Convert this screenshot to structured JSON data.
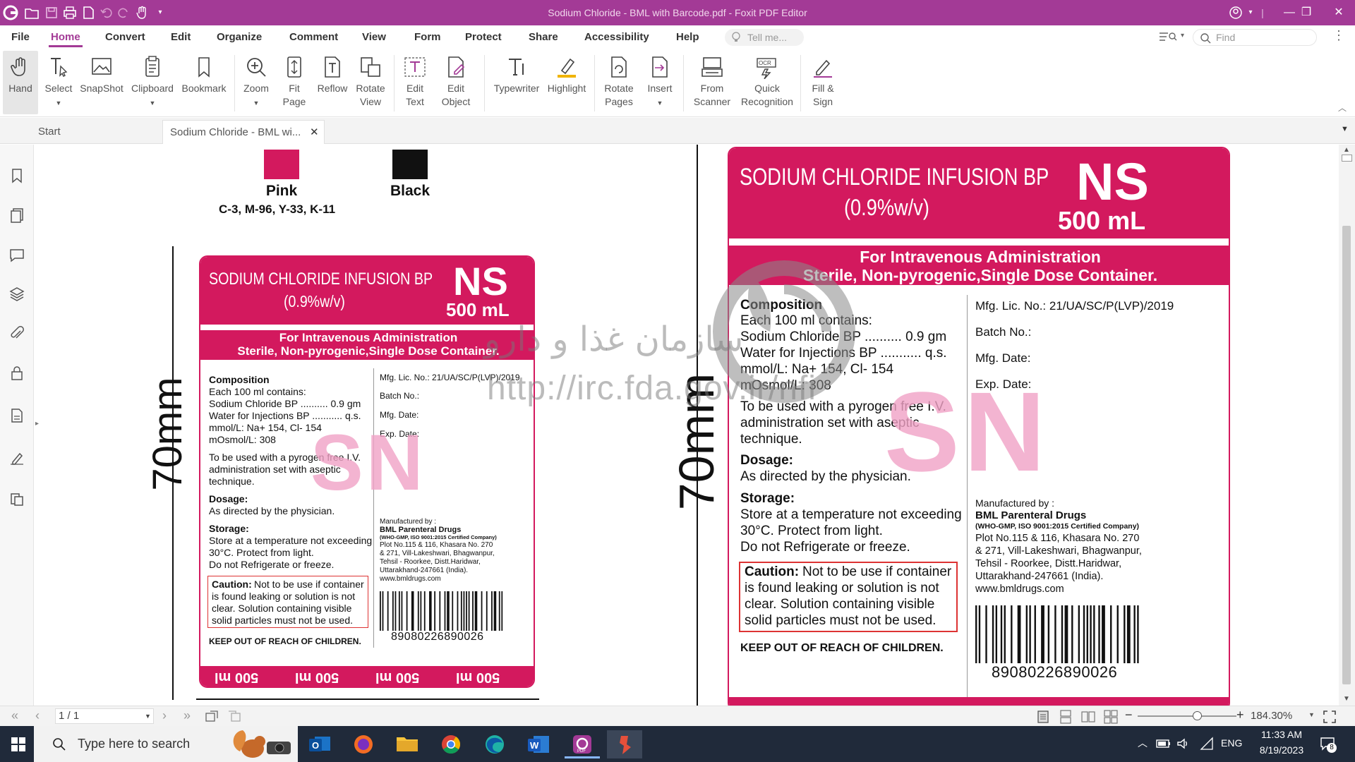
{
  "window": {
    "title": "Sodium Chloride - BML with Barcode.pdf - Foxit PDF Editor"
  },
  "menu": {
    "items": [
      "File",
      "Home",
      "Convert",
      "Edit",
      "Organize",
      "Comment",
      "View",
      "Form",
      "Protect",
      "Share",
      "Accessibility",
      "Help"
    ],
    "tell_me": "Tell me...",
    "find": "Find"
  },
  "ribbon": {
    "tools": [
      {
        "label": "Hand",
        "icon": "hand-icon"
      },
      {
        "label": "Select",
        "icon": "select-text-icon"
      },
      {
        "label": "SnapShot",
        "icon": "snapshot-icon"
      },
      {
        "label": "Clipboard",
        "icon": "clipboard-icon"
      },
      {
        "label": "Bookmark",
        "icon": "bookmark-icon"
      },
      {
        "label": "Zoom",
        "icon": "zoom-icon"
      },
      {
        "label": "Fit Page",
        "icon": "fit-page-icon"
      },
      {
        "label": "Reflow",
        "icon": "reflow-icon"
      },
      {
        "label": "Rotate View",
        "icon": "rotate-view-icon"
      },
      {
        "label": "Edit Text",
        "icon": "edit-text-icon"
      },
      {
        "label": "Edit Object",
        "icon": "edit-object-icon"
      },
      {
        "label": "Typewriter",
        "icon": "typewriter-icon"
      },
      {
        "label": "Highlight",
        "icon": "highlight-icon"
      },
      {
        "label": "Rotate Pages",
        "icon": "rotate-pages-icon"
      },
      {
        "label": "Insert",
        "icon": "insert-icon"
      },
      {
        "label": "From Scanner",
        "icon": "scanner-icon"
      },
      {
        "label": "Quick Recognition",
        "icon": "ocr-icon"
      },
      {
        "label": "Fill & Sign",
        "icon": "fill-sign-icon"
      }
    ]
  },
  "tabs": {
    "start": "Start",
    "document": "Sodium Chloride - BML wi..."
  },
  "document": {
    "swatches": [
      {
        "name": "Pink",
        "spec": "C-3, M-96, Y-33, K-11",
        "color": "#d3195e"
      },
      {
        "name": "Black",
        "spec": "",
        "color": "#111111"
      }
    ],
    "dimension_label": "70mm",
    "label": {
      "product": "SODIUM CHLORIDE INFUSION BP",
      "strength": "(0.9%w/v)",
      "code": "NS",
      "volume": "500 mL",
      "admin": "For Intravenous Administration",
      "container": "Sterile, Non-pyrogenic,Single Dose Container.",
      "composition_title": "Composition",
      "composition_lines": [
        "Each 100 ml contains:",
        "Sodium Chloride BP .......... 0.9 gm",
        "Water for Injections BP ........... q.s.",
        "mmol/L: Na+ 154, Cl- 154",
        "mOsmol/L: 308"
      ],
      "usage_lines": [
        "To be used with a pyrogen free I.V.",
        "administration set with aseptic",
        "technique."
      ],
      "dosage_title": "Dosage:",
      "dosage_text": "As directed by the physician.",
      "storage_title": "Storage:",
      "storage_lines": [
        "Store at a temperature not exceeding",
        "30°C. Protect from light.",
        "Do not Refrigerate or freeze."
      ],
      "caution_title": "Caution:",
      "caution_lines": [
        "Not to be use if container",
        "is found leaking or solution is not",
        "clear. Solution containing visible",
        "solid particles must not be used."
      ],
      "keep_out": "KEEP OUT OF REACH OF CHILDREN.",
      "mfg_lic": "Mfg. Lic. No.: 21/UA/SC/P(LVP)/2019",
      "batch": "Batch No.:",
      "mfg_date": "Mfg. Date:",
      "exp_date": "Exp. Date:",
      "manufactured_by": "Manufactured by :",
      "company": "BML Parenteral Drugs",
      "cert": "(WHO-GMP, ISO 9001:2015 Certified Company)",
      "address_lines": [
        "Plot No.115 & 116, Khasara No. 270",
        "& 271, Vill-Lakeshwari, Bhagwanpur,",
        "Tehsil - Roorkee, Distt.Haridwar,",
        "Uttarakhand-247661 (India)."
      ],
      "website": "www.bmldrugs.com",
      "barcode_number": "89080226890026",
      "footer_text": "500 ml",
      "sn_mark": "SN"
    },
    "watermark": {
      "persian": "سازمان غذا و دارو",
      "url": "http://irc.fda.gov.ir/nfi"
    }
  },
  "status": {
    "page": "1 / 1",
    "zoom": "184.30%"
  },
  "taskbar": {
    "search_placeholder": "Type here to search",
    "time": "11:33 AM",
    "date": "8/19/2023",
    "language": "ENG",
    "notifications": "8"
  }
}
